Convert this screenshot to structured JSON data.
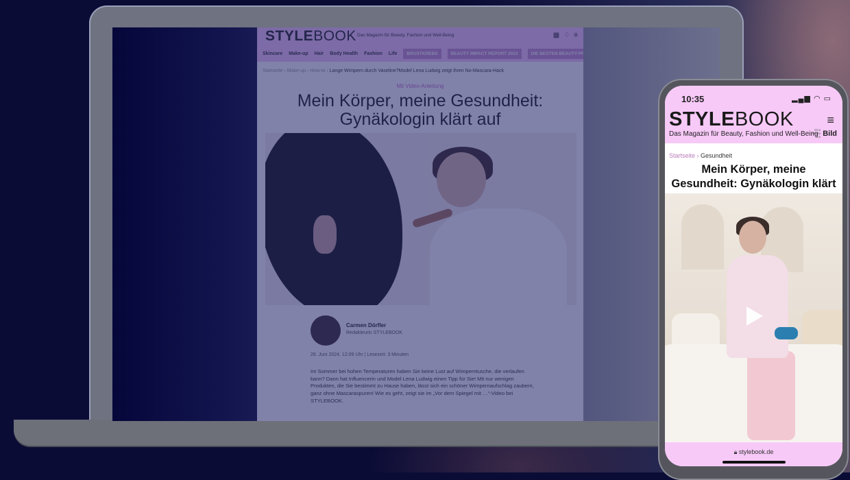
{
  "laptop_page": {
    "logo_bold": "STYLE",
    "logo_light": "BOOK",
    "tagline": "Das Magazin für Beauty, Fashion und Well-Being",
    "nav_items": [
      "Skincare",
      "Make-up",
      "Hair",
      "Body Health",
      "Fashion",
      "Life"
    ],
    "nav_pills": [
      "BRUSTKREBS",
      "BEAUTY IMPACT REPORT 2023",
      "DIE BESTEN BEAUTY-PR"
    ],
    "breadcrumb_trail": "Startseite › Make-up › How-to › ",
    "breadcrumb_current": "Lange Wimpern durch Vaseline?Model Lena Ludwig zeigt ihren No-Mascara-Hack",
    "kicker": "Mit Video-Anleitung",
    "title": "Mein Körper, meine Gesundheit: Gynäkologin klärt auf",
    "author_name": "Carmen Dörfler",
    "author_role": "Redakteurin STYLEBOOK",
    "date_line": "26. Juni 2024, 12:09 Uhr | Lesezeit: 3 Minuten",
    "body": "Im Sommer bei hohen Temperaturen haben Sie keine Lust auf Wimperntusche, die verlaufen kann? Dann hat Influencerin und Model Lena Ludwig einen Tipp für Sie! Mit nur wenigen Produkten, die Sie bestimmt zu Hause haben, lässt sich ein schöner Wimpernaufschlag zaubern, ganz ohne Mascaraspuren! Wie es geht, zeigt sie im „Vor dem Spiegel mit …“-Video bei STYLEBOOK."
  },
  "phone": {
    "time": "10:35",
    "status_icons": "signal-wifi-battery",
    "logo_bold": "STYLE",
    "logo_light": "BOOK",
    "tagline": "Das Magazin für Beauty, Fashion und Well-Being",
    "brand_small": "Eine Marke von",
    "brand_name": "Bild",
    "breadcrumb_home": "Startseite",
    "breadcrumb_current": "Gesundheit",
    "title": "Mein Körper, meine Gesundheit: Gynäkologin klärt auf",
    "url": "stylebook.de"
  },
  "colors": {
    "brand_pink": "#f3c8f6",
    "pill_pink": "#c88fcb",
    "background_navy": "#0b0c36"
  }
}
